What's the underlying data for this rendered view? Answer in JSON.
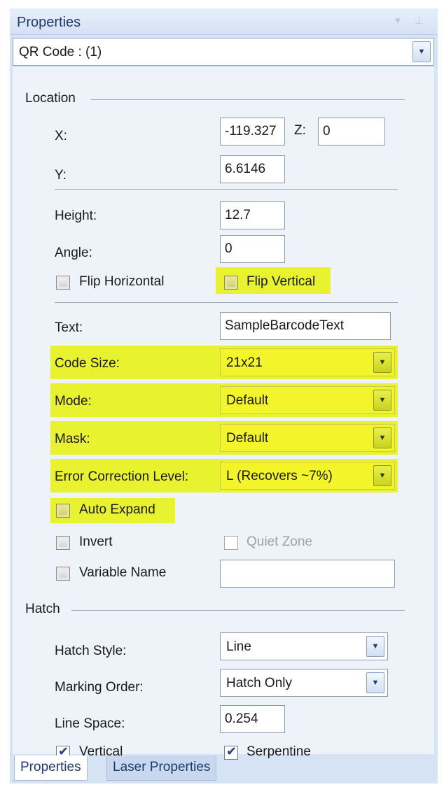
{
  "window": {
    "title": "Properties"
  },
  "object_selector": {
    "value": "QR Code : (1)"
  },
  "location": {
    "group_label": "Location",
    "x_label": "X:",
    "x_value": "-119.327",
    "z_label": "Z:",
    "z_value": "0",
    "y_label": "Y:",
    "y_value": "6.6146",
    "height_label": "Height:",
    "height_value": "12.7",
    "angle_label": "Angle:",
    "angle_value": "0",
    "flip_horizontal_label": "Flip Horizontal",
    "flip_vertical_label": "Flip Vertical"
  },
  "barcode": {
    "text_label": "Text:",
    "text_value": "SampleBarcodeText",
    "code_size_label": "Code Size:",
    "code_size_value": "21x21",
    "mode_label": "Mode:",
    "mode_value": "Default",
    "mask_label": "Mask:",
    "mask_value": "Default",
    "ecl_label": "Error Correction Level:",
    "ecl_value": "L (Recovers ~7%)",
    "auto_expand_label": "Auto Expand",
    "invert_label": "Invert",
    "quiet_zone_label": "Quiet Zone",
    "variable_name_label": "Variable Name",
    "variable_name_value": ""
  },
  "hatch": {
    "group_label": "Hatch",
    "hatch_style_label": "Hatch Style:",
    "hatch_style_value": "Line",
    "marking_order_label": "Marking Order:",
    "marking_order_value": "Hatch Only",
    "line_space_label": "Line Space:",
    "line_space_value": "0.254",
    "vertical_label": "Vertical",
    "vertical_checked": true,
    "serpentine_label": "Serpentine",
    "serpentine_checked": true
  },
  "tabs": {
    "properties": "Properties",
    "laser_properties": "Laser Properties"
  },
  "colors": {
    "highlight": "#e8f22e",
    "panel": "#eef3fa",
    "accent": "#1e3a6e"
  },
  "icons": {
    "dropdown": "chevron-down-icon",
    "check": "check-icon"
  }
}
